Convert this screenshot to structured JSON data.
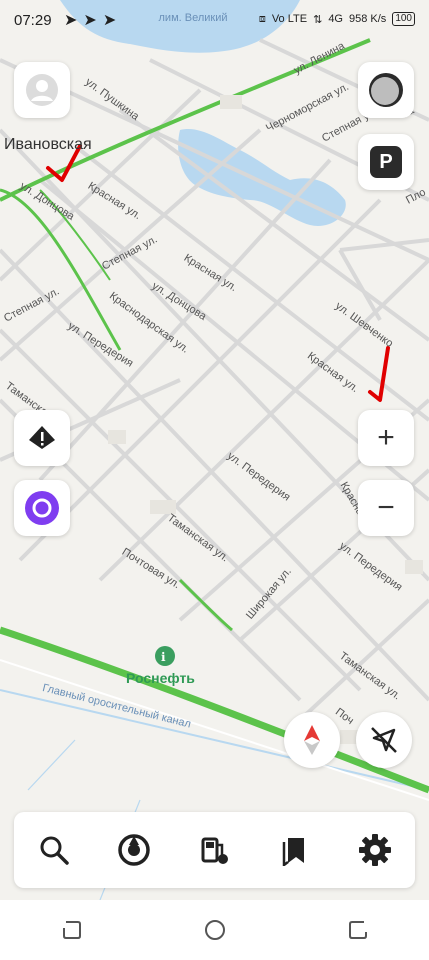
{
  "status_bar": {
    "time": "07:29",
    "left_icons": [
      "navigation-arrow-icon",
      "navigation-arrow-icon",
      "navigation-arrow-icon"
    ],
    "network_1": "Vo LTE",
    "network_2": "4G",
    "speed": "958 K/s",
    "battery": "100"
  },
  "map": {
    "labels": {
      "lake": "лим. Великий",
      "district": "Ивановская",
      "lenina": "ул. Ленина",
      "pushkina": "ул. Пушкина",
      "chernomorskaya": "Черноморская ул.",
      "stepnaya_top": "Степная ул.",
      "krasnaya_1": "Красная ул.",
      "dontsova_1": "ул. Донцова",
      "stepnaya_mid": "Степная ул.",
      "krasnaya_2": "Красная ул.",
      "dontsova_2": "ул. Донцова",
      "stepnaya_left": "Степная ул.",
      "krasnodarskaya": "Краснодарская ул.",
      "perederia_1": "ул. Передерия",
      "shevchenko": "ул. Шевченко",
      "krasnaya_3": "Красная ул.",
      "tamanskaya_1": "Таманская ул.",
      "perederia_2": "ул. Передерия",
      "krasnaya_4": "Красная ул.",
      "tamanskaya_2": "Таманская ул.",
      "perederia_3": "ул. Передерия",
      "pochtovaya_1": "Почтовая ул.",
      "shirokaya": "Широкая ул.",
      "tamanskaya_3": "Таманская ул.",
      "pochtovaya_2": "Поч",
      "canal": "Главный оросительный канал",
      "rosneft": "Роснефть",
      "plo": "Пло",
      "lenina_vo": "ва"
    },
    "colors": {
      "road_major": "#5cc34b",
      "road_minor": "#d8d8d8",
      "water": "#b8d8f0",
      "annotation": "#e00000"
    }
  },
  "controls": {
    "profile": "avatar-icon",
    "layers": "layers-icon",
    "parking": "P",
    "warning": "road-alert-icon",
    "alice": "alice-icon",
    "zoom_in": "+",
    "zoom_out": "−",
    "compass": "compass-icon",
    "location": "location-off-icon"
  },
  "bottom_bar": {
    "items": [
      "search-icon",
      "navigator-icon",
      "gas-station-icon",
      "bookmarks-icon",
      "settings-icon"
    ]
  },
  "system_nav": {
    "items": [
      "recent-apps-icon",
      "home-icon",
      "back-icon"
    ]
  }
}
